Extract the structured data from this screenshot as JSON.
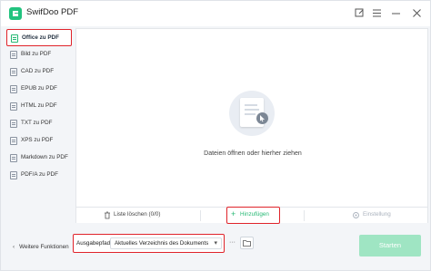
{
  "app": {
    "title": "SwifDoo PDF",
    "accent": "#25b873",
    "highlight": "#e0232a"
  },
  "sidebar": {
    "items": [
      {
        "label": "Office zu PDF",
        "active": true
      },
      {
        "label": "Bild zu PDF"
      },
      {
        "label": "CAD zu PDF"
      },
      {
        "label": "EPUB zu PDF"
      },
      {
        "label": "HTML zu PDF"
      },
      {
        "label": "TXT zu PDF"
      },
      {
        "label": "XPS zu PDF"
      },
      {
        "label": "Markdown zu PDF"
      },
      {
        "label": "PDF/A zu PDF"
      }
    ]
  },
  "main": {
    "drop_text": "Dateien öffnen oder hierher ziehen",
    "actions": {
      "clear_label": "Liste löschen (0/0)",
      "add_label": "Hinzufügen",
      "settings_label": "Einstellung"
    }
  },
  "bottom": {
    "more_label": "Weitere Funktionen",
    "output_label": "Ausgabepfad:",
    "output_value": "Aktuelles Verzeichnis des Dokuments",
    "browse_label": "···",
    "start_label": "Starten"
  }
}
